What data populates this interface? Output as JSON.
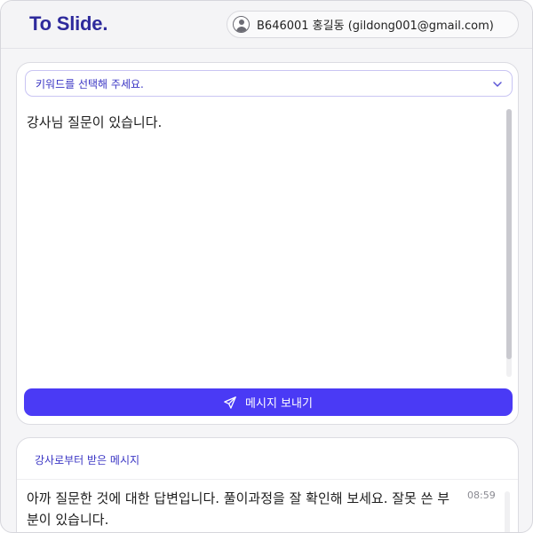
{
  "header": {
    "logo": "To Slide.",
    "user_label": "B646001 홍길동  (gildong001@gmail.com)",
    "user_icon": "user-circle-icon"
  },
  "compose": {
    "keyword_placeholder": "키워드를 선택해 주세요.",
    "message_text": "강사님 질문이 있습니다.",
    "send_label": "메시지 보내기",
    "send_icon": "paper-plane-icon",
    "accent": "#4a3af5"
  },
  "received": {
    "title": "강사로부터 받은 메시지",
    "messages": [
      {
        "text": "아까 질문한 것에 대한 답변입니다. 풀이과정을 잘 확인해 보세요. 잘못 쓴 부분이 있습니다.",
        "time": "08:59"
      }
    ]
  }
}
